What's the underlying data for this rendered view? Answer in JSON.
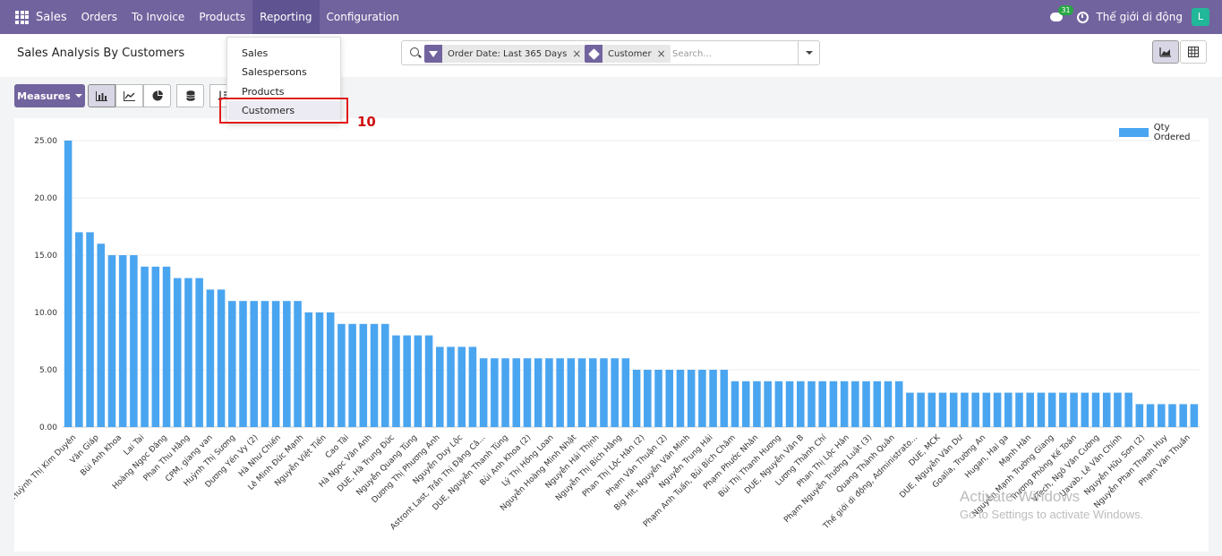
{
  "navbar": {
    "app_title": "Sales",
    "menu": [
      "Orders",
      "To Invoice",
      "Products",
      "Reporting",
      "Configuration"
    ],
    "active_menu": "Reporting",
    "chat_count": "31",
    "company": "Thế giới di động",
    "avatar_letter": "L"
  },
  "control": {
    "page_title": "Sales Analysis By Customers",
    "facets": [
      "Order Date: Last 365 Days",
      "Customer"
    ],
    "search_placeholder": "Search..."
  },
  "dropdown": {
    "items": [
      "Sales",
      "Salespersons",
      "Products",
      "Customers"
    ],
    "highlighted": "Customers"
  },
  "annotation": {
    "number": "10",
    "color": "#e01b1b"
  },
  "toolbar": {
    "measures_label": "Measures"
  },
  "colors": {
    "brand": "#71639e",
    "bar": "#4aa5f0"
  },
  "chart_data": {
    "type": "bar",
    "legend": "Qty Ordered",
    "legend_position": "top-right",
    "ylim": [
      0,
      25
    ],
    "yticks": [
      "0.00",
      "5.00",
      "10.00",
      "15.00",
      "20.00",
      "25.00"
    ],
    "grid": true,
    "categories": [
      "Huỳnh Thị Kim Duyên",
      "Văn Giáp",
      "Bùi Anh Khoa",
      "Lai Tai",
      "Hoàng Ngọc Đăng",
      "Phan Thu Hằng",
      "CPM, giang van",
      "Huỳnh Thị Sương",
      "Dương Yến Vy (2)",
      "Hà Như Chiến",
      "Lê Minh Đức Mạnh",
      "Nguyễn Việt Tiến",
      "Cao Tài",
      "Hà Ngọc Văn Anh",
      "DUE, Hà Trung Đức",
      "Nguyễn Quang Tùng",
      "Dương Thị Phương Anh",
      "Nguyễn Duy Lộc",
      "Astront Last, Trần Thị Đặng Câ...",
      "DUE, Nguyễn Thanh Tùng",
      "Bùi Anh Khoa (2)",
      "Lý Thị Hồng Loan",
      "Nguyễn Hoàng Minh Nhật",
      "Nguyễn Hải Thịnh",
      "Nguyễn Thị Bích Hằng",
      "Phan Thị Lộc Hân (2)",
      "Phạm Văn Thuận (2)",
      "Big Hit, Nguyễn Văn Minh",
      "Nguyễn Trung Hải",
      "Phạm Anh Tuấn, Bùi Bích Châm",
      "Phạm Phước Nhân",
      "Bùi Thị Thanh Hương",
      "DUE, Nguyễn Văn B",
      "Lương Thành Chí",
      "Phan Thị Lộc Hân",
      "Phạm Nguyễn Trường Luật (3)",
      "Quang Thành Quân",
      "Thế giới di động, Administrato...",
      "DUE, MCK",
      "DUE, Nguyễn Văn Dư",
      "Goalia, Trường An",
      "Hugan, Hai ga",
      "Mạnh Hân",
      "Nguyễn Mạnh Trường Giang",
      "Trương Phòng Kế Toán",
      "VTech, Ngô Văn Cường",
      "Uavab, Lê Văn Chính",
      "Nguyễn Hữu Sơn (2)",
      "Nguyễn Phan Thanh Huy",
      "Phạm Văn Thuần"
    ],
    "values": [
      25,
      17,
      17,
      16,
      15,
      15,
      15,
      14,
      14,
      14,
      13,
      13,
      13,
      12,
      12,
      11,
      11,
      11,
      11,
      11,
      11,
      11,
      10,
      10,
      10,
      9,
      9,
      9,
      9,
      9,
      8,
      8,
      8,
      8,
      7,
      7,
      7,
      7,
      6,
      6,
      6,
      6,
      6,
      6,
      6,
      6,
      6,
      6,
      6,
      6,
      6,
      6,
      5,
      5,
      5,
      5,
      5,
      5,
      5,
      5,
      5,
      4,
      4,
      4,
      4,
      4,
      4,
      4,
      4,
      4,
      4,
      4,
      4,
      4,
      4,
      4,
      4,
      3,
      3,
      3,
      3,
      3,
      3,
      3,
      3,
      3,
      3,
      3,
      3,
      3,
      3,
      3,
      3,
      3,
      3,
      3,
      3,
      3,
      2,
      2,
      2,
      2,
      2,
      2
    ]
  },
  "watermark": {
    "line1": "Activate Windows",
    "line2": "Go to Settings to activate Windows."
  }
}
